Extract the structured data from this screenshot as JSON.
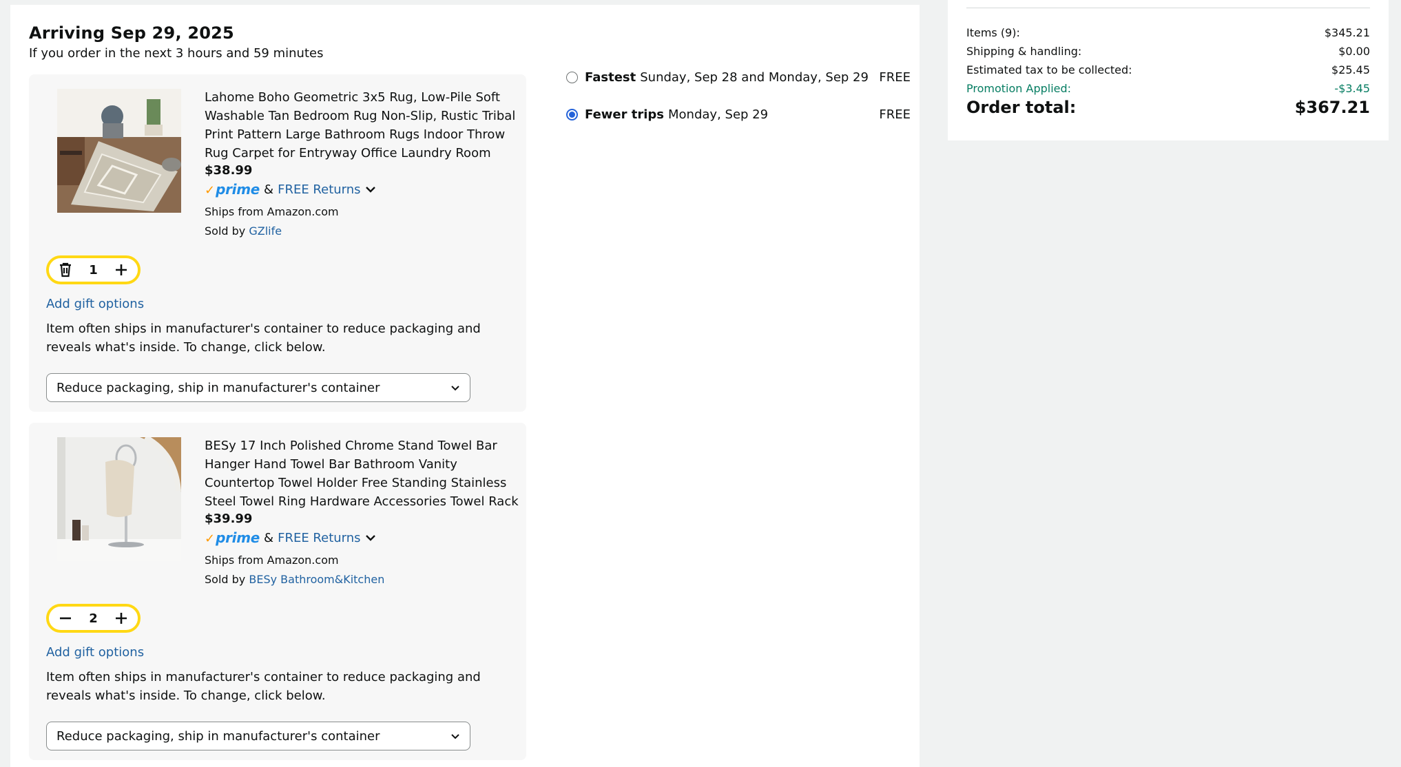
{
  "delivery": {
    "title": "Arriving Sep 29, 2025",
    "subtitle": "If you order in the next 3 hours and 59 minutes"
  },
  "items": [
    {
      "title": "Lahome Boho Geometric 3x5 Rug, Low-Pile Soft Washable Tan Bedroom Rug Non-Slip, Rustic Tribal Print Pattern Large Bathroom Rugs Indoor Throw Rug Carpet for Entryway Office Laundry Room",
      "price": "$38.99",
      "prime": "prime",
      "amp": "&",
      "returns": "FREE Returns",
      "ships_from": "Ships from Amazon.com",
      "sold_by_label": "Sold by",
      "seller": "GZlife",
      "quantity": "1",
      "gift": "Add gift options",
      "pack_note": "Item often ships in manufacturer's container to reduce packaging and reveals what's inside. To change, click below.",
      "pack_select": "Reduce packaging, ship in manufacturer's container"
    },
    {
      "title": "BESy 17 Inch Polished Chrome Stand Towel Bar Hanger Hand Towel Bar Bathroom Vanity Countertop Towel Holder Free Standing Stainless Steel Towel Ring Hardware Accessories Towel Rack",
      "price": "$39.99",
      "prime": "prime",
      "amp": "&",
      "returns": "FREE Returns",
      "ships_from": "Ships from Amazon.com",
      "sold_by_label": "Sold by",
      "seller": "BESy Bathroom&Kitchen",
      "quantity": "2",
      "gift": "Add gift options",
      "pack_note": "Item often ships in manufacturer's container to reduce packaging and reveals what's inside. To change, click below.",
      "pack_select": "Reduce packaging, ship in manufacturer's container"
    }
  ],
  "shipping_options": [
    {
      "label": "Fastest",
      "date": "Sunday, Sep 28 and Monday, Sep 29",
      "price": "FREE",
      "selected": false
    },
    {
      "label": "Fewer trips",
      "date": "Monday, Sep 29",
      "price": "FREE",
      "selected": true
    }
  ],
  "summary": {
    "items_label": "Items (9):",
    "items_value": "$345.21",
    "shipping_label": "Shipping & handling:",
    "shipping_value": "$0.00",
    "tax_label": "Estimated tax to be collected:",
    "tax_value": "$25.45",
    "promo_label": "Promotion Applied:",
    "promo_value": "-$3.45",
    "total_label": "Order total:",
    "total_value": "$367.21"
  },
  "colors": {
    "link": "#2162a1",
    "qty_border": "#ffd814",
    "promo": "#067d62",
    "prime": "#1f8ce6",
    "prime_check": "#ff9900",
    "radio_selected": "#2563d9"
  },
  "icons": [
    "trash-icon",
    "plus-icon",
    "minus-icon",
    "chevron-down-icon"
  ]
}
